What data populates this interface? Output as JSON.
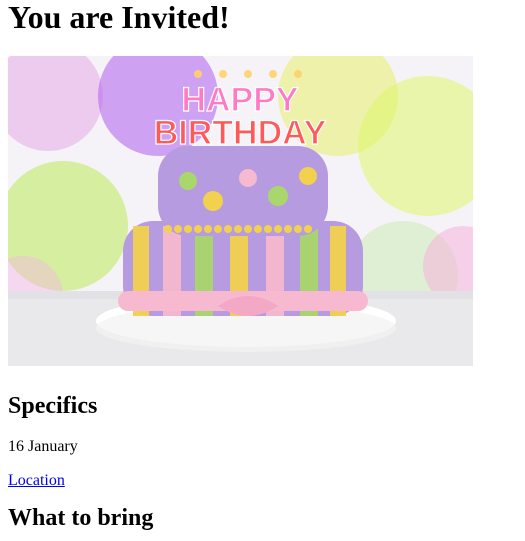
{
  "page": {
    "title": "You are Invited!",
    "image": {
      "alt": "Birthday cake with HAPPY BIRTHDAY candles",
      "candles_text_top": "HAPPY",
      "candles_text_bottom": "BIRTHDAY",
      "colors": {
        "background": "#f3f1f6",
        "cake_purple": "#b79be0",
        "cake_pink": "#f6b9cf",
        "cake_yellow": "#f2d14e",
        "cake_green": "#a9d76b",
        "plate": "#ffffff"
      }
    },
    "specifics": {
      "heading": "Specifics",
      "date": "16 January",
      "location_link": "Location"
    },
    "what_to_bring": {
      "heading": "What to bring"
    }
  }
}
